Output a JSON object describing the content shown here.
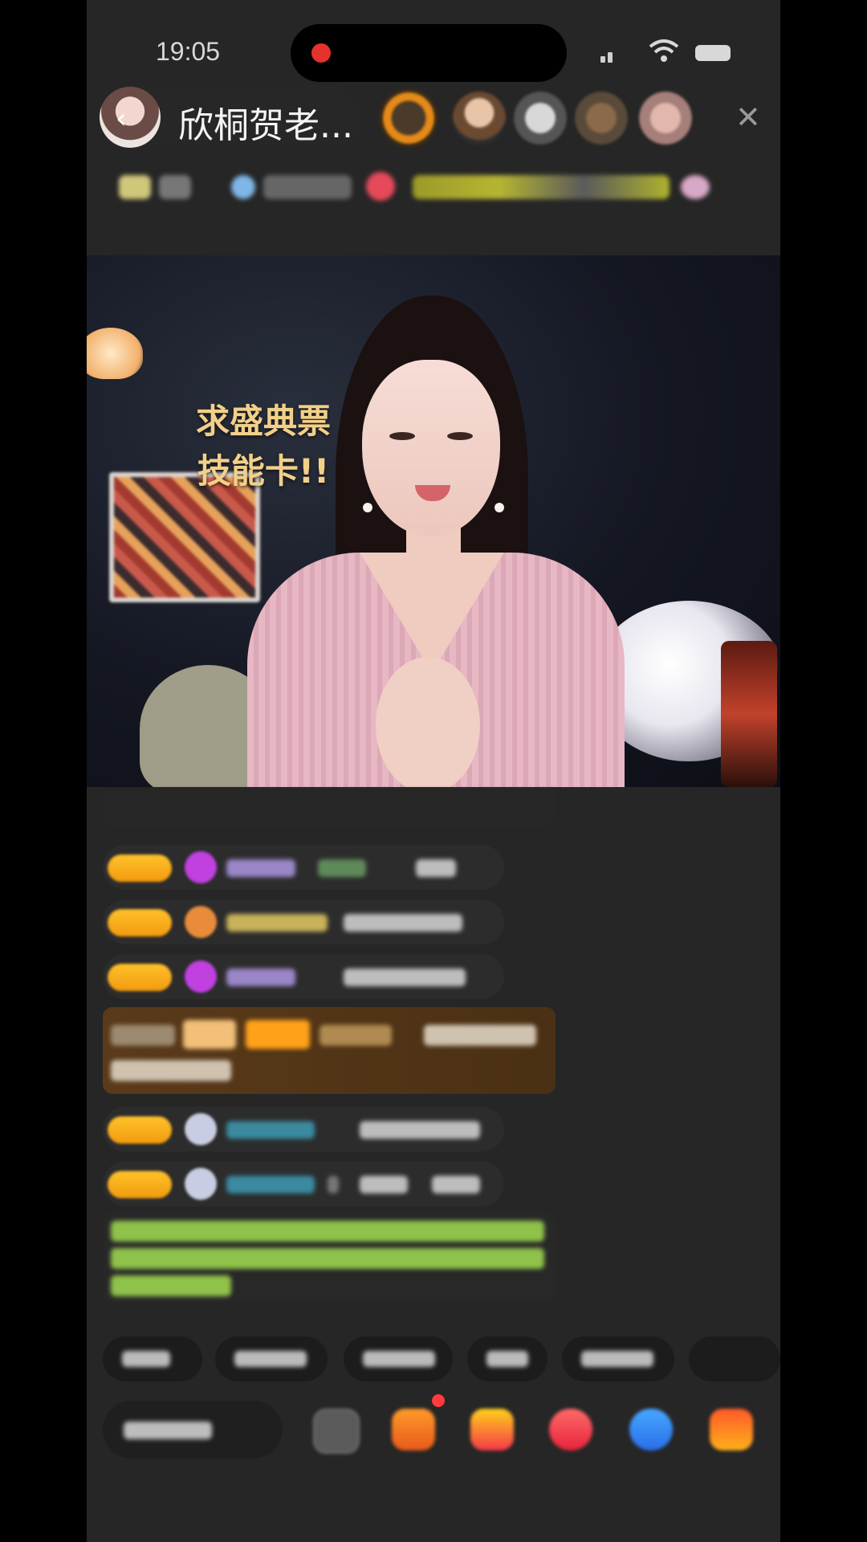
{
  "status_bar": {
    "time": "19:05"
  },
  "header": {
    "anchor_name": "欣桐贺老...",
    "back_icon": "chevron-left-icon",
    "close_icon": "close-icon"
  },
  "video": {
    "caption_line1": "求盛典票",
    "caption_line2": "技能卡!!"
  },
  "colors": {
    "background": "#262626",
    "level_badge": "#f5a51a",
    "caption": "#f2d089",
    "system_green": "#8fc24a",
    "recording": "#e5322c"
  }
}
